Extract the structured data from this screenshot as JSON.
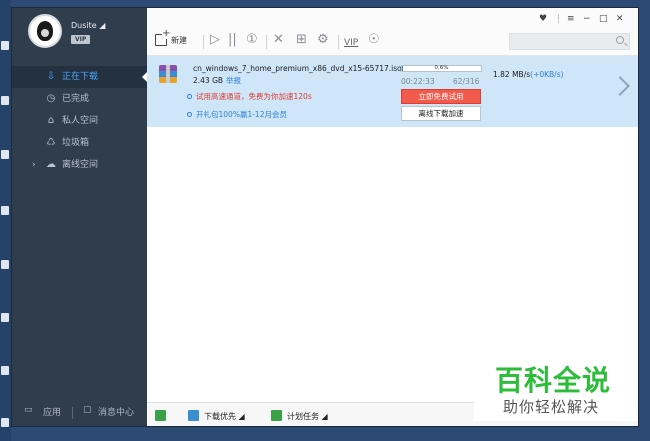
{
  "sidebar": {
    "user": {
      "name": "Dusite ◢",
      "badge": "VIP"
    },
    "items": [
      {
        "label": "正在下载",
        "icon": "⇩"
      },
      {
        "label": "已完成",
        "icon": "◷"
      },
      {
        "label": "私人空间",
        "icon": "⌂"
      },
      {
        "label": "垃圾箱",
        "icon": "♺"
      },
      {
        "label": "离线空间",
        "icon": "☁"
      }
    ],
    "bottom": {
      "apps": "应用",
      "messages": "消息中心"
    }
  },
  "toolbar": {
    "new_label": "新建",
    "vip_label": "VIP",
    "search_placeholder": ""
  },
  "task": {
    "file_name": "cn_windows_7_home_premium_x86_dvd_x15-65717.iso",
    "size": "2.43 GB",
    "report": "举报",
    "tip_trial": "试用高速通道，免费为你加速120s",
    "tip_gift": "开礼包100%赢1-12月会员",
    "progress_text": "0.6%",
    "progress_fraction": 0.006,
    "time": "00:22:33",
    "pieces": "62/316",
    "speed": "1.82   MB/s",
    "speed_accel": "(+0KB/s)",
    "btn_trial": "立即免费试用",
    "btn_offline": "离线下载加速"
  },
  "statusbar": {
    "priority": "下载优先 ◢",
    "schedule": "计划任务 ◢"
  },
  "watermark": {
    "title": "百科全说",
    "subtitle": "助你轻松解决"
  },
  "colors": {
    "sidebar_bg": "#2f3d4d",
    "active_blue": "#4aa8ff",
    "row_highlight": "#cfe6f9",
    "trial_red": "#f25a4c",
    "watermark_green": "#2dbd3a"
  }
}
